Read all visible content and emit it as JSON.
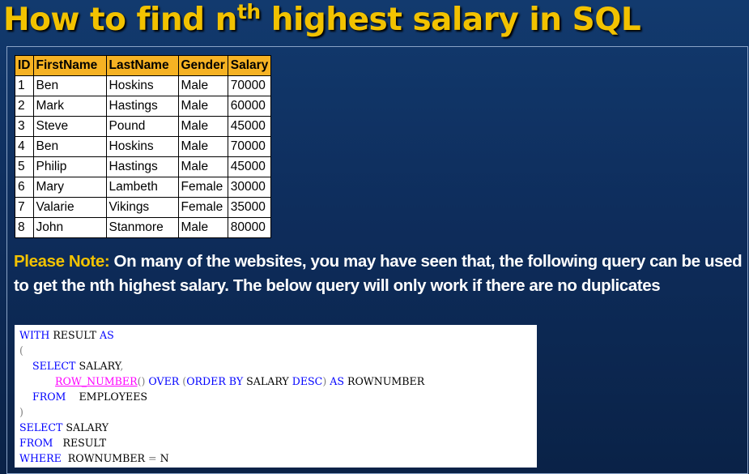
{
  "title": {
    "main": "How to find n",
    "sup": "th",
    "rest": " highest salary in SQL"
  },
  "table": {
    "headers": [
      "ID",
      "FirstName",
      "LastName",
      "Gender",
      "Salary"
    ],
    "rows": [
      [
        "1",
        "Ben",
        "Hoskins",
        "Male",
        "70000"
      ],
      [
        "2",
        "Mark",
        "Hastings",
        "Male",
        "60000"
      ],
      [
        "3",
        "Steve",
        "Pound",
        "Male",
        "45000"
      ],
      [
        "4",
        "Ben",
        "Hoskins",
        "Male",
        "70000"
      ],
      [
        "5",
        "Philip",
        "Hastings",
        "Male",
        "45000"
      ],
      [
        "6",
        "Mary",
        "Lambeth",
        "Female",
        "30000"
      ],
      [
        "7",
        "Valarie",
        "Vikings",
        "Female",
        "35000"
      ],
      [
        "8",
        "John",
        "Stanmore",
        "Male",
        "80000"
      ]
    ]
  },
  "note": {
    "label": "Please Note:",
    "text": " On many of the websites, you may have seen that, the following query can be used to get the nth highest salary. The below query will only work if there are no duplicates"
  },
  "code": {
    "l1_kw1": "WITH",
    "l1_t1": " RESULT ",
    "l1_kw2": "AS",
    "l2_p": "(",
    "l3_i": "    ",
    "l3_kw": "SELECT",
    "l3_t": " SALARY",
    "l3_p": ",",
    "l4_i": "           ",
    "l4_fn": "ROW_NUMBER",
    "l4_p1": "()",
    "l4_s1": " ",
    "l4_kw1": "OVER",
    "l4_s2": " ",
    "l4_p2": "(",
    "l4_kw2": "ORDER BY",
    "l4_t1": " SALARY ",
    "l4_kw3": "DESC",
    "l4_p3": ")",
    "l4_s3": " ",
    "l4_kw4": "AS",
    "l4_t2": " ROWNUMBER",
    "l5_i": "    ",
    "l5_kw": "FROM",
    "l5_t": "    EMPLOYEES",
    "l6_p": ")",
    "l7_kw": "SELECT",
    "l7_t": " SALARY",
    "l8_kw": "FROM",
    "l8_t": "   RESULT",
    "l9_kw": "WHERE",
    "l9_t": "  ROWNUMBER ",
    "l9_p": "=",
    "l9_t2": " N"
  },
  "colors": {
    "title": "#f2c200",
    "header_fill": "#f6b223",
    "note_label": "#f2c200",
    "sql_keyword": "#0000ff",
    "sql_function": "#ff00ff",
    "sql_punctuation": "#808080"
  }
}
